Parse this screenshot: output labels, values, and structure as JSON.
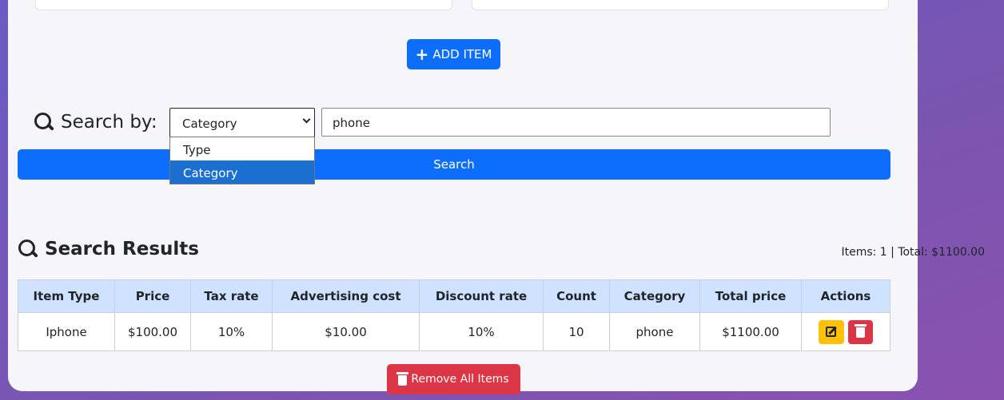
{
  "form": {
    "add_item_label": "ADD ITEM"
  },
  "search": {
    "label": "Search by:",
    "selected_field": "Category",
    "options": [
      "Type",
      "Category"
    ],
    "query": "phone",
    "button_label": "Search"
  },
  "results": {
    "title": "Search Results",
    "summary": "Items: 1 | Total: $1100.00",
    "columns": [
      "Item Type",
      "Price",
      "Tax rate",
      "Advertising cost",
      "Discount rate",
      "Count",
      "Category",
      "Total price",
      "Actions"
    ],
    "rows": [
      {
        "item_type": "Iphone",
        "price": "$100.00",
        "tax_rate": "10%",
        "advertising_cost": "$10.00",
        "discount_rate": "10%",
        "count": "10",
        "category": "phone",
        "total_price": "$1100.00"
      }
    ],
    "remove_all_label": "Remove All Items"
  },
  "colors": {
    "primary": "#0d6efd",
    "danger": "#dc3545",
    "warning": "#ffc107",
    "table_header": "#cfe2ff"
  }
}
